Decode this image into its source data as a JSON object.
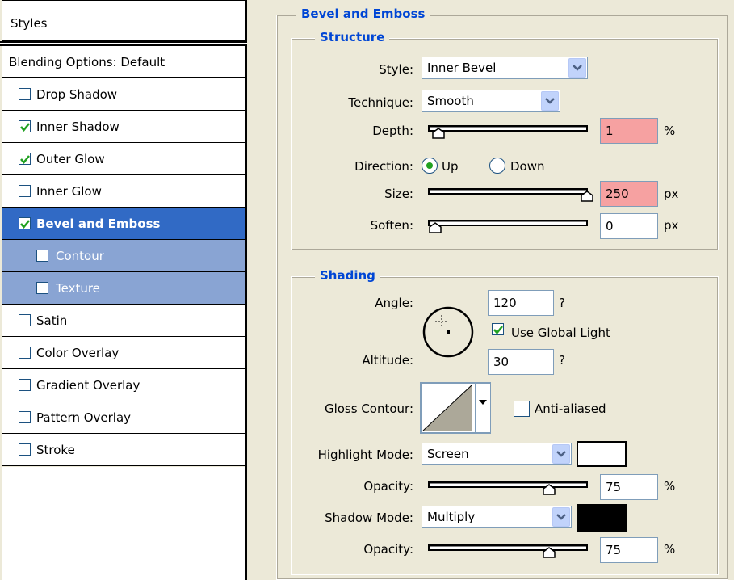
{
  "styles_panel": {
    "header": "Styles",
    "blending_options": "Blending Options: Default",
    "items": [
      {
        "label": "Drop Shadow",
        "checked": false
      },
      {
        "label": "Inner Shadow",
        "checked": true
      },
      {
        "label": "Outer Glow",
        "checked": true
      },
      {
        "label": "Inner Glow",
        "checked": false
      },
      {
        "label": "Bevel and Emboss",
        "checked": true,
        "selected": true
      },
      {
        "label": "Contour",
        "checked": false,
        "sub": true
      },
      {
        "label": "Texture",
        "checked": false,
        "sub": true
      },
      {
        "label": "Satin",
        "checked": false
      },
      {
        "label": "Color Overlay",
        "checked": false
      },
      {
        "label": "Gradient Overlay",
        "checked": false
      },
      {
        "label": "Pattern Overlay",
        "checked": false
      },
      {
        "label": "Stroke",
        "checked": false
      }
    ]
  },
  "bevel": {
    "title": "Bevel and Emboss",
    "structure": {
      "title": "Structure",
      "style_label": "Style:",
      "style_value": "Inner Bevel",
      "technique_label": "Technique:",
      "technique_value": "Smooth",
      "depth_label": "Depth:",
      "depth_value": "1",
      "depth_unit": "%",
      "depth_slider": 0.01,
      "direction_label": "Direction:",
      "direction_up": "Up",
      "direction_down": "Down",
      "direction_selected": "Up",
      "size_label": "Size:",
      "size_value": "250",
      "size_unit": "px",
      "size_slider": 1.0,
      "soften_label": "Soften:",
      "soften_value": "0",
      "soften_unit": "px",
      "soften_slider": 0.0
    },
    "shading": {
      "title": "Shading",
      "angle_label": "Angle:",
      "angle_value": "120",
      "angle_suffix": "?",
      "use_global_light": "Use Global Light",
      "use_global_light_checked": true,
      "altitude_label": "Altitude:",
      "altitude_value": "30",
      "altitude_suffix": "?",
      "gloss_label": "Gloss Contour:",
      "anti_aliased": "Anti-aliased",
      "anti_aliased_checked": false,
      "highlight_mode_label": "Highlight Mode:",
      "highlight_mode_value": "Screen",
      "highlight_color": "#ffffff",
      "highlight_opacity_label": "Opacity:",
      "highlight_opacity_value": "75",
      "highlight_opacity_unit": "%",
      "highlight_opacity_slider": 0.75,
      "shadow_mode_label": "Shadow Mode:",
      "shadow_mode_value": "Multiply",
      "shadow_color": "#000000",
      "shadow_opacity_label": "Opacity:",
      "shadow_opacity_value": "75",
      "shadow_opacity_unit": "%",
      "shadow_opacity_slider": 0.75
    }
  }
}
